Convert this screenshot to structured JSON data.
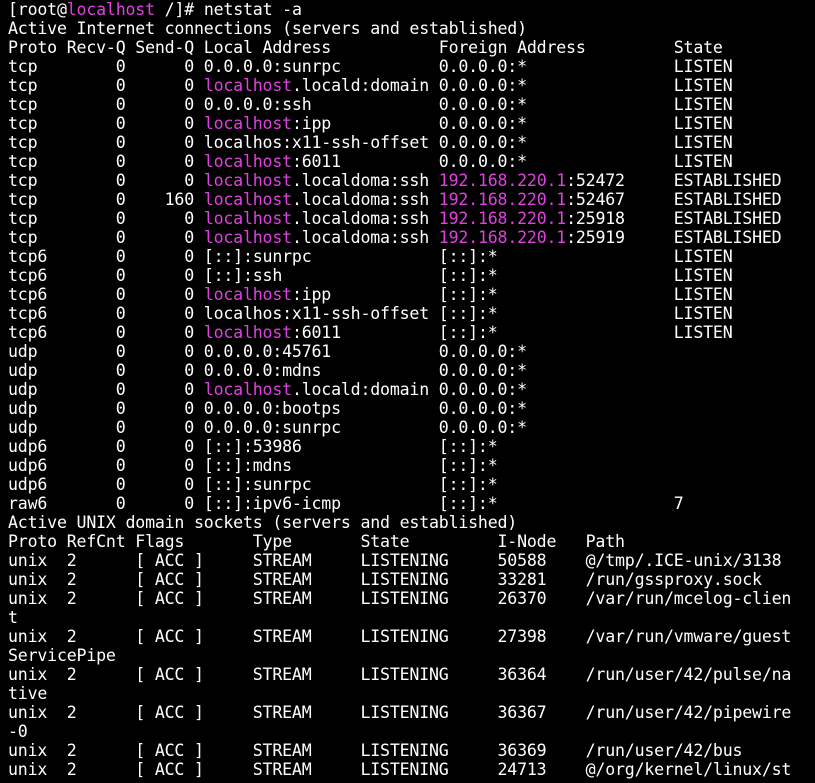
{
  "colors": {
    "background": "#000000",
    "foreground": "#ffffff",
    "highlight": "#e040e0"
  },
  "lines": [
    [
      {
        "t": "[root@"
      },
      {
        "t": "localhost",
        "hl": true
      },
      {
        "t": " /]# netstat -a"
      }
    ],
    [
      {
        "t": "Active Internet connections (servers and established)"
      }
    ],
    [
      {
        "t": "Proto Recv-Q Send-Q Local Address           Foreign Address         State"
      }
    ],
    [
      {
        "t": "tcp        0      0 0.0.0.0:sunrpc          0.0.0.0:*               LISTEN"
      }
    ],
    [
      {
        "t": "tcp        0      0 "
      },
      {
        "t": "localhost",
        "hl": true
      },
      {
        "t": ".locald:domain 0.0.0.0:*               LISTEN"
      }
    ],
    [
      {
        "t": "tcp        0      0 0.0.0.0:ssh             0.0.0.0:*               LISTEN"
      }
    ],
    [
      {
        "t": "tcp        0      0 "
      },
      {
        "t": "localhost",
        "hl": true
      },
      {
        "t": ":ipp           0.0.0.0:*               LISTEN"
      }
    ],
    [
      {
        "t": "tcp        0      0 localhos:x11-ssh-offset 0.0.0.0:*               LISTEN"
      }
    ],
    [
      {
        "t": "tcp        0      0 "
      },
      {
        "t": "localhost",
        "hl": true
      },
      {
        "t": ":6011          0.0.0.0:*               LISTEN"
      }
    ],
    [
      {
        "t": "tcp        0      0 "
      },
      {
        "t": "localhost",
        "hl": true
      },
      {
        "t": ".localdoma:ssh "
      },
      {
        "t": "192.168.220.1",
        "hl": true
      },
      {
        "t": ":52472     ESTABLISHED"
      }
    ],
    [
      {
        "t": "tcp        0    160 "
      },
      {
        "t": "localhost",
        "hl": true
      },
      {
        "t": ".localdoma:ssh "
      },
      {
        "t": "192.168.220.1",
        "hl": true
      },
      {
        "t": ":52467     ESTABLISHED"
      }
    ],
    [
      {
        "t": "tcp        0      0 "
      },
      {
        "t": "localhost",
        "hl": true
      },
      {
        "t": ".localdoma:ssh "
      },
      {
        "t": "192.168.220.1",
        "hl": true
      },
      {
        "t": ":25918     ESTABLISHED"
      }
    ],
    [
      {
        "t": "tcp        0      0 "
      },
      {
        "t": "localhost",
        "hl": true
      },
      {
        "t": ".localdoma:ssh "
      },
      {
        "t": "192.168.220.1",
        "hl": true
      },
      {
        "t": ":25919     ESTABLISHED"
      }
    ],
    [
      {
        "t": "tcp6       0      0 [::]:sunrpc             [::]:*                  LISTEN"
      }
    ],
    [
      {
        "t": "tcp6       0      0 [::]:ssh                [::]:*                  LISTEN"
      }
    ],
    [
      {
        "t": "tcp6       0      0 "
      },
      {
        "t": "localhost",
        "hl": true
      },
      {
        "t": ":ipp           [::]:*                  LISTEN"
      }
    ],
    [
      {
        "t": "tcp6       0      0 localhos:x11-ssh-offset [::]:*                  LISTEN"
      }
    ],
    [
      {
        "t": "tcp6       0      0 "
      },
      {
        "t": "localhost",
        "hl": true
      },
      {
        "t": ":6011          [::]:*                  LISTEN"
      }
    ],
    [
      {
        "t": "udp        0      0 0.0.0.0:45761           0.0.0.0:*"
      }
    ],
    [
      {
        "t": "udp        0      0 0.0.0.0:mdns            0.0.0.0:*"
      }
    ],
    [
      {
        "t": "udp        0      0 "
      },
      {
        "t": "localhost",
        "hl": true
      },
      {
        "t": ".locald:domain 0.0.0.0:*"
      }
    ],
    [
      {
        "t": "udp        0      0 0.0.0.0:bootps          0.0.0.0:*"
      }
    ],
    [
      {
        "t": "udp        0      0 0.0.0.0:sunrpc          0.0.0.0:*"
      }
    ],
    [
      {
        "t": "udp6       0      0 [::]:53986              [::]:*"
      }
    ],
    [
      {
        "t": "udp6       0      0 [::]:mdns               [::]:*"
      }
    ],
    [
      {
        "t": "udp6       0      0 [::]:sunrpc             [::]:*"
      }
    ],
    [
      {
        "t": "raw6       0      0 [::]:ipv6-icmp          [::]:*                  7"
      }
    ],
    [
      {
        "t": "Active UNIX domain sockets (servers and established)"
      }
    ],
    [
      {
        "t": "Proto RefCnt Flags       Type       State         I-Node   Path"
      }
    ],
    [
      {
        "t": "unix  2      [ ACC ]     STREAM     LISTENING     50588    @/tmp/.ICE-unix/3138"
      }
    ],
    [
      {
        "t": "unix  2      [ ACC ]     STREAM     LISTENING     33281    /run/gssproxy.sock"
      }
    ],
    [
      {
        "t": "unix  2      [ ACC ]     STREAM     LISTENING     26370    /var/run/mcelog-clien"
      }
    ],
    [
      {
        "t": "t"
      }
    ],
    [
      {
        "t": "unix  2      [ ACC ]     STREAM     LISTENING     27398    /var/run/vmware/guest"
      }
    ],
    [
      {
        "t": "ServicePipe"
      }
    ],
    [
      {
        "t": "unix  2      [ ACC ]     STREAM     LISTENING     36364    /run/user/42/pulse/na"
      }
    ],
    [
      {
        "t": "tive"
      }
    ],
    [
      {
        "t": "unix  2      [ ACC ]     STREAM     LISTENING     36367    /run/user/42/pipewire"
      }
    ],
    [
      {
        "t": "-0"
      }
    ],
    [
      {
        "t": "unix  2      [ ACC ]     STREAM     LISTENING     36369    /run/user/42/bus"
      }
    ],
    [
      {
        "t": "unix  2      [ ACC ]     STREAM     LISTENING     24713    @/org/kernel/linux/st"
      }
    ]
  ]
}
